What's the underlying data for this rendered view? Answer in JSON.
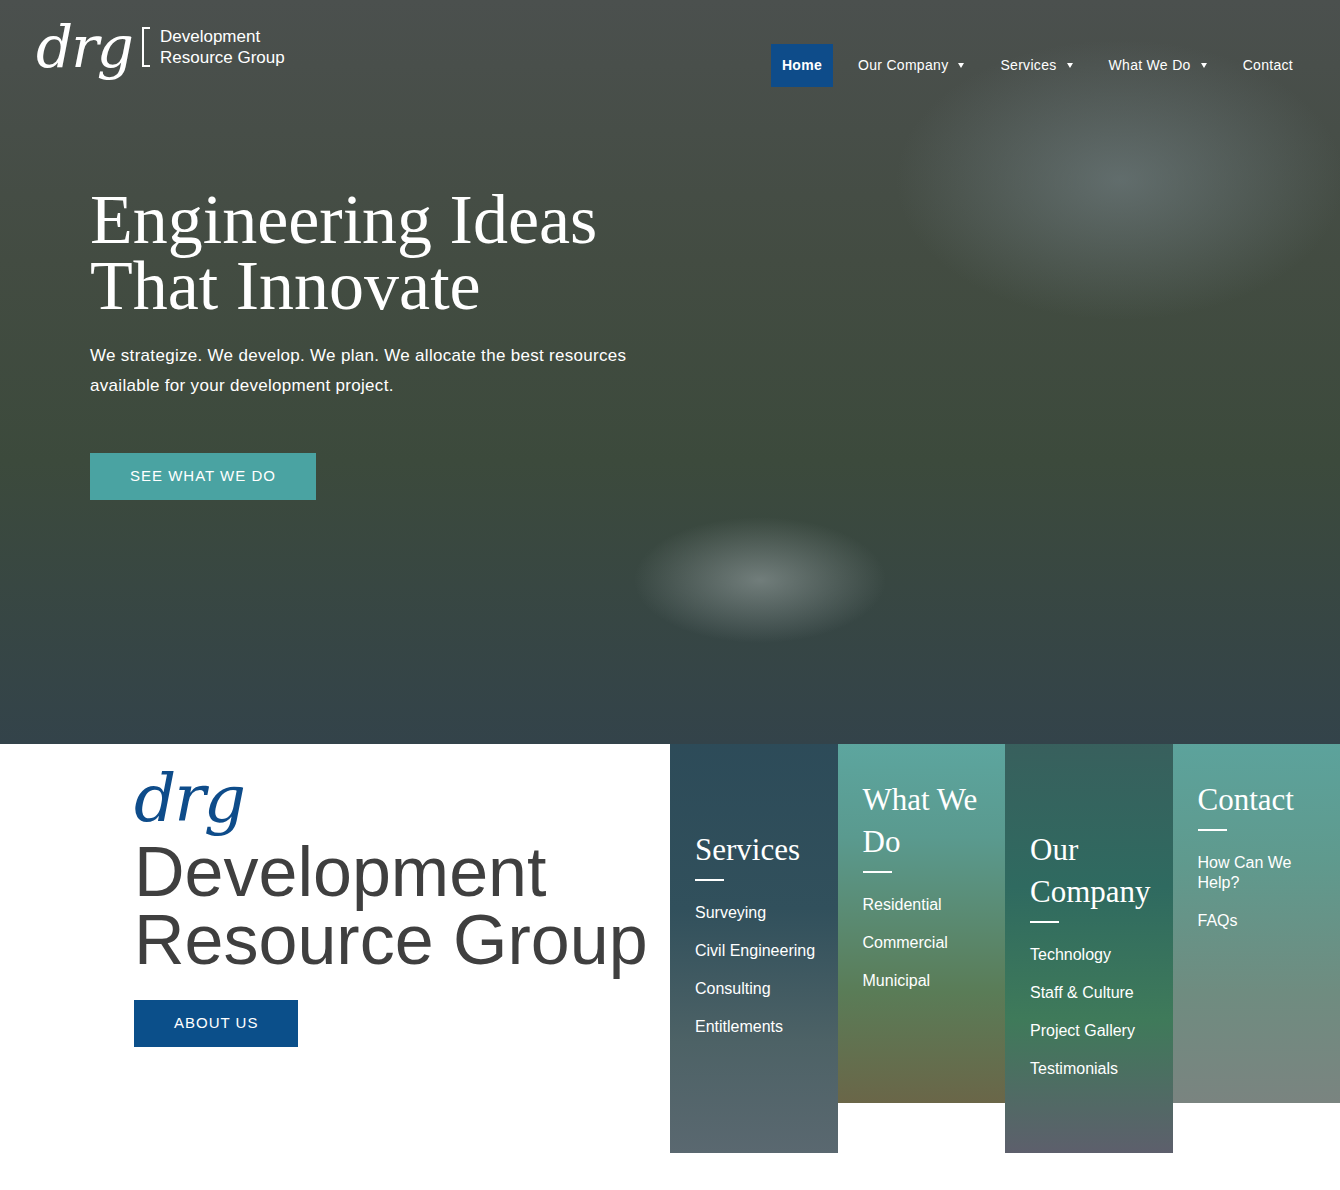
{
  "logo": {
    "mark": "drg",
    "line1": "Development",
    "line2": "Resource Group"
  },
  "nav": [
    {
      "label": "Home",
      "selected": true,
      "dropdown": false
    },
    {
      "label": "Our Company",
      "selected": false,
      "dropdown": true
    },
    {
      "label": "Services",
      "selected": false,
      "dropdown": true
    },
    {
      "label": "What We Do",
      "selected": false,
      "dropdown": true
    },
    {
      "label": "Contact",
      "selected": false,
      "dropdown": false
    }
  ],
  "hero": {
    "title": "Engineering Ideas That Innovate",
    "subtitle": "We strategize. We develop. We plan. We allocate the best resources available for your development project.",
    "button": "SEE WHAT WE DO"
  },
  "about": {
    "mark": "drg",
    "title": "Development Resource Group",
    "button": "ABOUT US"
  },
  "tiles": [
    {
      "title": "Services",
      "links": [
        "Surveying",
        "Civil Engineering",
        "Consulting",
        "Entitlements"
      ]
    },
    {
      "title": "What We Do",
      "links": [
        "Residential",
        "Commercial",
        "Municipal"
      ]
    },
    {
      "title": "Our Company",
      "links": [
        "Technology",
        "Staff & Culture",
        "Project Gallery",
        "Testimonials"
      ]
    },
    {
      "title": "Contact",
      "links": [
        "How Can We Help?",
        "FAQs"
      ]
    }
  ]
}
